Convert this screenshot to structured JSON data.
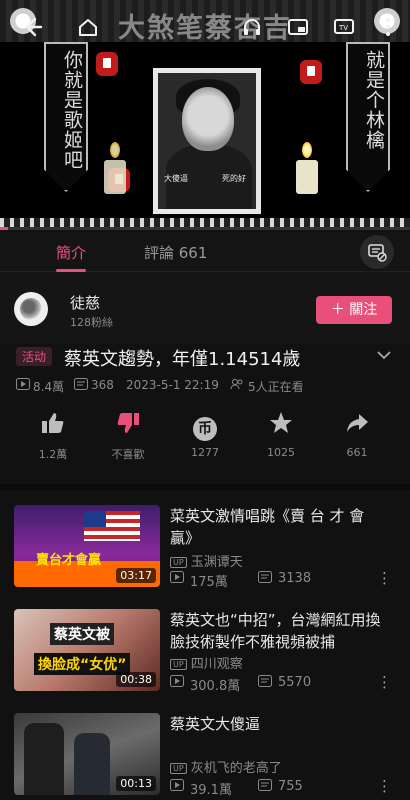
{
  "player": {
    "header_title": "大煞笔蔡杏吉",
    "left_banner": "你就是歌姬吧",
    "right_banner": "就是个林檎",
    "portrait_caption_left": "大傻逼",
    "portrait_caption_right": "死的好",
    "progress_fraction": 0.02,
    "icons": [
      "back-icon",
      "home-icon",
      "headphones-icon",
      "pip-icon",
      "tv-cast-icon",
      "more-icon"
    ]
  },
  "tabs": {
    "intro": "簡介",
    "comments": "評論 661"
  },
  "uploader": {
    "name": "徒慈",
    "fans": "128粉絲",
    "follow": "＋ 關注"
  },
  "video": {
    "tag": "活动",
    "title": "蔡英文趨勢，年僅1.14514歲",
    "views": "8.4萬",
    "danmaku": "368",
    "date": "2023-5-1 22:19",
    "watching": "5人正在看"
  },
  "actions": [
    {
      "label": "1.2萬",
      "icon": "like-icon"
    },
    {
      "label": "不喜歡",
      "icon": "dislike-icon"
    },
    {
      "label": "1277",
      "icon": "coin-icon"
    },
    {
      "label": "1025",
      "icon": "star-icon"
    },
    {
      "label": "661",
      "icon": "share-icon"
    }
  ],
  "related": [
    {
      "title": "菜英文激情唱跳《賣 台 才 會 贏》",
      "uploader": "玉渊谭天",
      "views": "175萬",
      "danmaku": "3138",
      "duration": "03:17",
      "thumb_text": "賣台才會贏"
    },
    {
      "title": "蔡英文也“中招”，台灣網紅用換臉技術製作不雅視頻被捕",
      "uploader": "四川观察",
      "views": "300.8萬",
      "danmaku": "5570",
      "duration": "00:38",
      "thumb_text_1": "蔡英文被",
      "thumb_text_2": "換脸成“女优”"
    },
    {
      "title": "蔡英文大傻逼",
      "uploader": "灰机飞的老高了",
      "views": "39.1萬",
      "danmaku": "755",
      "duration": "00:13"
    }
  ],
  "colors": {
    "accent": "#e8507a",
    "background": "#111111"
  }
}
